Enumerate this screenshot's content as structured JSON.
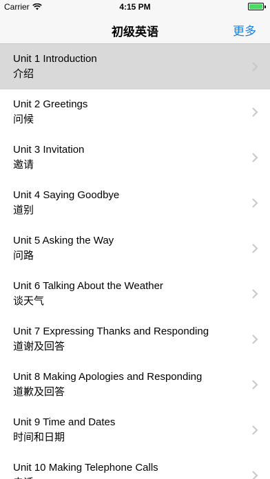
{
  "status_bar": {
    "carrier": "Carrier",
    "time": "4:15 PM"
  },
  "nav": {
    "title": "初级英语",
    "more_label": "更多"
  },
  "units": [
    {
      "title": "Unit 1 Introduction",
      "subtitle": "介绍",
      "selected": true
    },
    {
      "title": "Unit 2 Greetings",
      "subtitle": "问候"
    },
    {
      "title": "Unit 3 Invitation",
      "subtitle": "邀请"
    },
    {
      "title": "Unit 4 Saying Goodbye",
      "subtitle": "道别"
    },
    {
      "title": "Unit 5 Asking the Way",
      "subtitle": "问路"
    },
    {
      "title": "Unit 6 Talking About the Weather",
      "subtitle": "谈天气"
    },
    {
      "title": "Unit 7 Expressing Thanks and Responding",
      "subtitle": "道谢及回答"
    },
    {
      "title": "Unit 8 Making Apologies and Responding",
      "subtitle": "道歉及回答"
    },
    {
      "title": "Unit 9 Time and Dates",
      "subtitle": "时间和日期"
    },
    {
      "title": "Unit 10 Making Telephone Calls",
      "subtitle": "电话"
    }
  ],
  "colors": {
    "accent": "#1a7ee6",
    "selected_row": "#d9d9d9",
    "battery": "#4cd964"
  }
}
